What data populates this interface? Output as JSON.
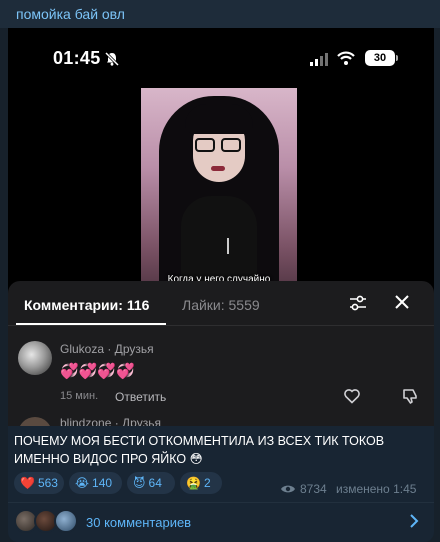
{
  "channel": {
    "title": "помойка бай овл"
  },
  "phone": {
    "time": "01:45",
    "battery": "30",
    "video_caption": "Когда у него случайно вывалилось яйко из мини шортиков"
  },
  "sheet": {
    "tab_comments": "Комментарии: 116",
    "tab_likes": "Лайки: 5559",
    "comment": {
      "author": "Glukoza · Друзья",
      "text": "💞💞💞💞",
      "time": "15 мин.",
      "reply": "Ответить"
    },
    "comment2": {
      "author": "blindzone · Друзья"
    }
  },
  "caption": "ПОЧЕМУ МОЯ БЕСТИ ОТКОММЕНТИЛА ИЗ ВСЕХ ТИК ТОКОВ ИМЕННО ВИДОС ПРО ЯЙКО 😳",
  "reactions": [
    {
      "emoji": "❤️",
      "count": "563"
    },
    {
      "emoji": "😭",
      "count": "140"
    },
    {
      "emoji": "😈",
      "count": "64"
    },
    {
      "emoji": "🤮",
      "count": "2"
    }
  ],
  "meta": {
    "views": "8734",
    "edited": "изменено 1:45"
  },
  "footer": {
    "comments_link": "30 комментариев"
  },
  "colors": {
    "background": "#17212b",
    "accent": "#5eb5f7",
    "reaction_bg": "#233447"
  }
}
